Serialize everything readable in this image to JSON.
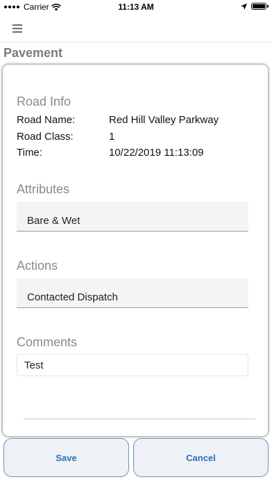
{
  "status_bar": {
    "carrier": "Carrier",
    "time": "11:13 AM",
    "battery_level_percent": 100,
    "icons": [
      "signal-dots-icon",
      "wifi-icon",
      "location-arrow-icon",
      "battery-icon"
    ]
  },
  "nav": {
    "menu_icon": "hamburger-menu-icon",
    "title": "Pavement"
  },
  "road_info": {
    "heading": "Road Info",
    "rows": [
      {
        "label": "Road Name:",
        "value": "Red Hill Valley Parkway"
      },
      {
        "label": "Road Class:",
        "value": "1"
      },
      {
        "label": "Time:",
        "value": "10/22/2019 11:13:09"
      }
    ]
  },
  "attributes": {
    "heading": "Attributes",
    "selected": "Bare & Wet"
  },
  "actions": {
    "heading": "Actions",
    "selected": "Contacted Dispatch"
  },
  "comments": {
    "heading": "Comments",
    "value": "Test"
  },
  "buttons": {
    "save_label": "Save",
    "cancel_label": "Cancel"
  },
  "colors": {
    "button_text": "#2f6fb4",
    "button_border": "#6f95b8",
    "button_bg": "#eef1f6",
    "section_heading": "#8a8a8a",
    "page_title": "#7b7b7b"
  }
}
